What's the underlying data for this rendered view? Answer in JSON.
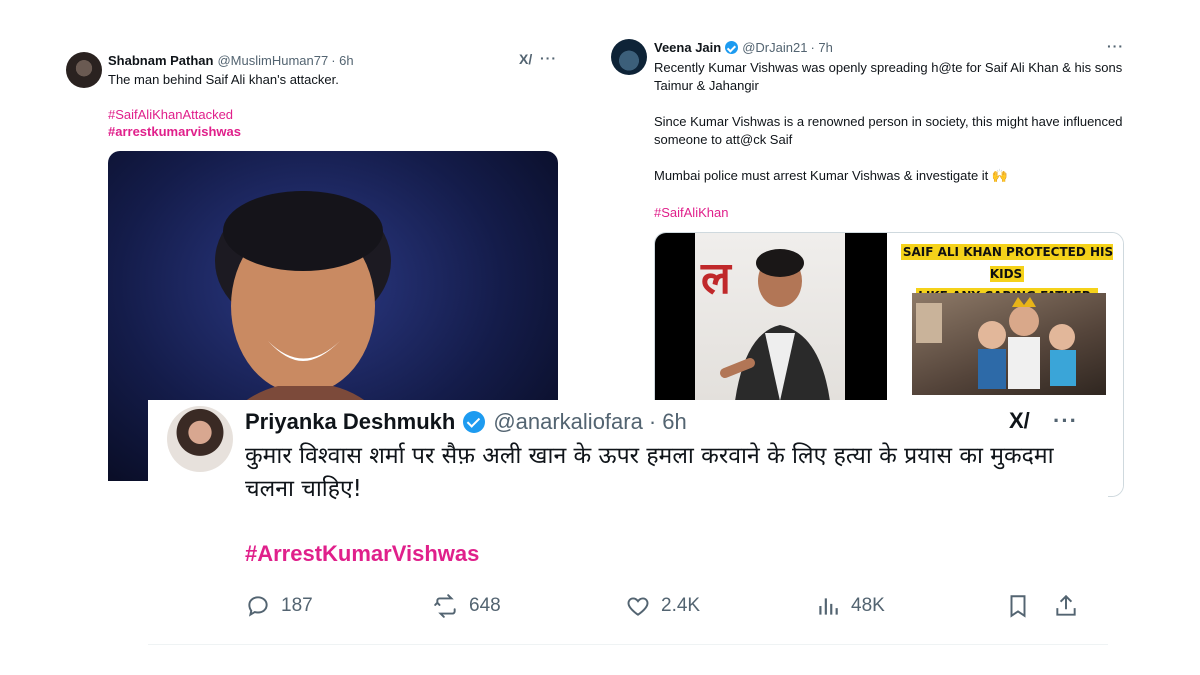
{
  "tweet_left": {
    "display_name": "Shabnam Pathan",
    "handle": "@MuslimHuman77",
    "time": "· 6h",
    "text": "The man behind Saif Ali khan's attacker.",
    "hashtags": [
      "#SaifAliKhanAttacked",
      "#arrestkumarvishwas"
    ],
    "grok_icon": "grok-icon",
    "more_icon": "more-icon"
  },
  "tweet_right": {
    "display_name": "Veena Jain",
    "handle": "@DrJain21",
    "time": "· 7h",
    "paragraphs": [
      "Recently Kumar Vishwas was openly spreading h@te for Saif Ali Khan & his sons Taimur & Jahangir",
      "Since Kumar Vishwas is a renowned person in society, this might have influenced someone to att@ck Saif",
      "Mumbai police must arrest Kumar Vishwas & investigate it 🙌"
    ],
    "hashtag": "#SaifAliKhan",
    "poster_title_line1": "SAIF ALI KHAN PROTECTED HIS KIDS",
    "poster_title_line2": "LIKE ANY CARING FATHER.",
    "more_icon": "more-icon"
  },
  "tweet_front": {
    "display_name": "Priyanka Deshmukh",
    "handle": "@anarkaliofara",
    "time": "· 6h",
    "text": "कुमार विश्वास शर्मा पर सैफ़ अली खान के ऊपर हमला करवाने के लिए हत्या के प्रयास का मुकदमा चलना चाहिए!",
    "hashtag": "#ArrestKumarVishwas",
    "actions": {
      "replies": "187",
      "reposts": "648",
      "likes": "2.4K",
      "views": "48K"
    }
  },
  "colors": {
    "hashtag": "#e0208b",
    "verified": "#1d9bf0",
    "muted_text": "#536471"
  }
}
